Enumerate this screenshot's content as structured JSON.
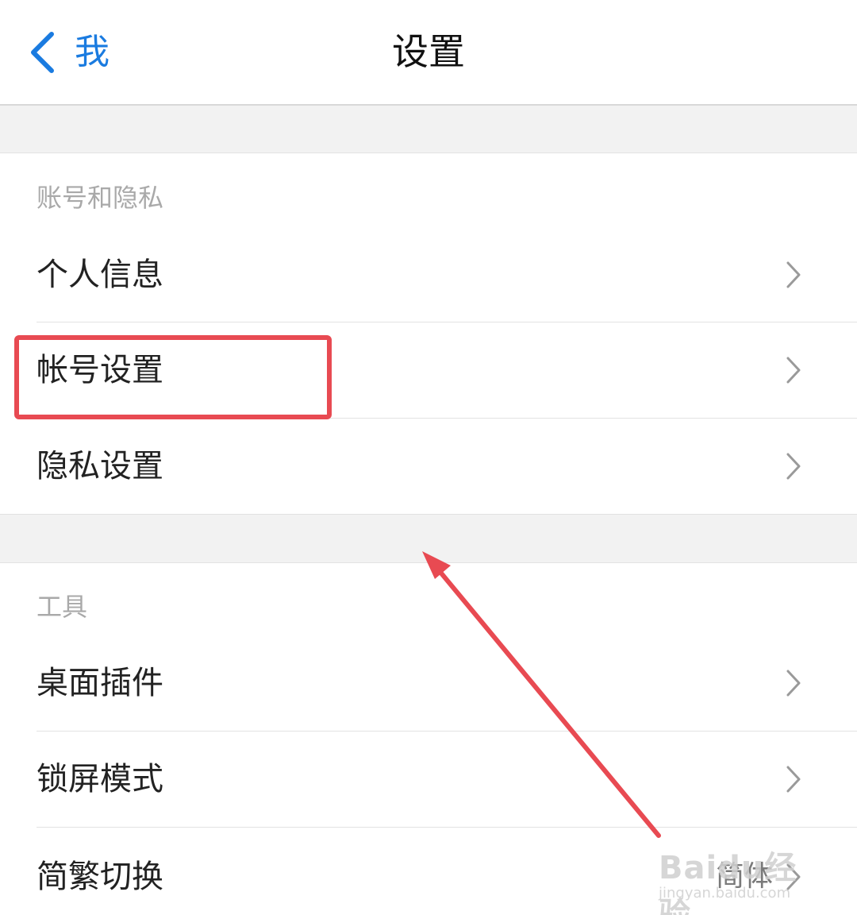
{
  "header": {
    "back_label": "我",
    "title": "设置",
    "accent_color": "#1a7be0"
  },
  "sections": {
    "account": {
      "header": "账号和隐私",
      "items": [
        {
          "label": "个人信息"
        },
        {
          "label": "帐号设置"
        },
        {
          "label": "隐私设置"
        }
      ]
    },
    "tools": {
      "header": "工具",
      "items": [
        {
          "label": "桌面插件"
        },
        {
          "label": "锁屏模式"
        },
        {
          "label": "简繁切换",
          "value": "简体"
        }
      ]
    }
  },
  "annotation": {
    "highlight_color": "#e84a52"
  },
  "watermark": {
    "main": "Baidu经验",
    "sub": "jingyan.baidu.com"
  }
}
